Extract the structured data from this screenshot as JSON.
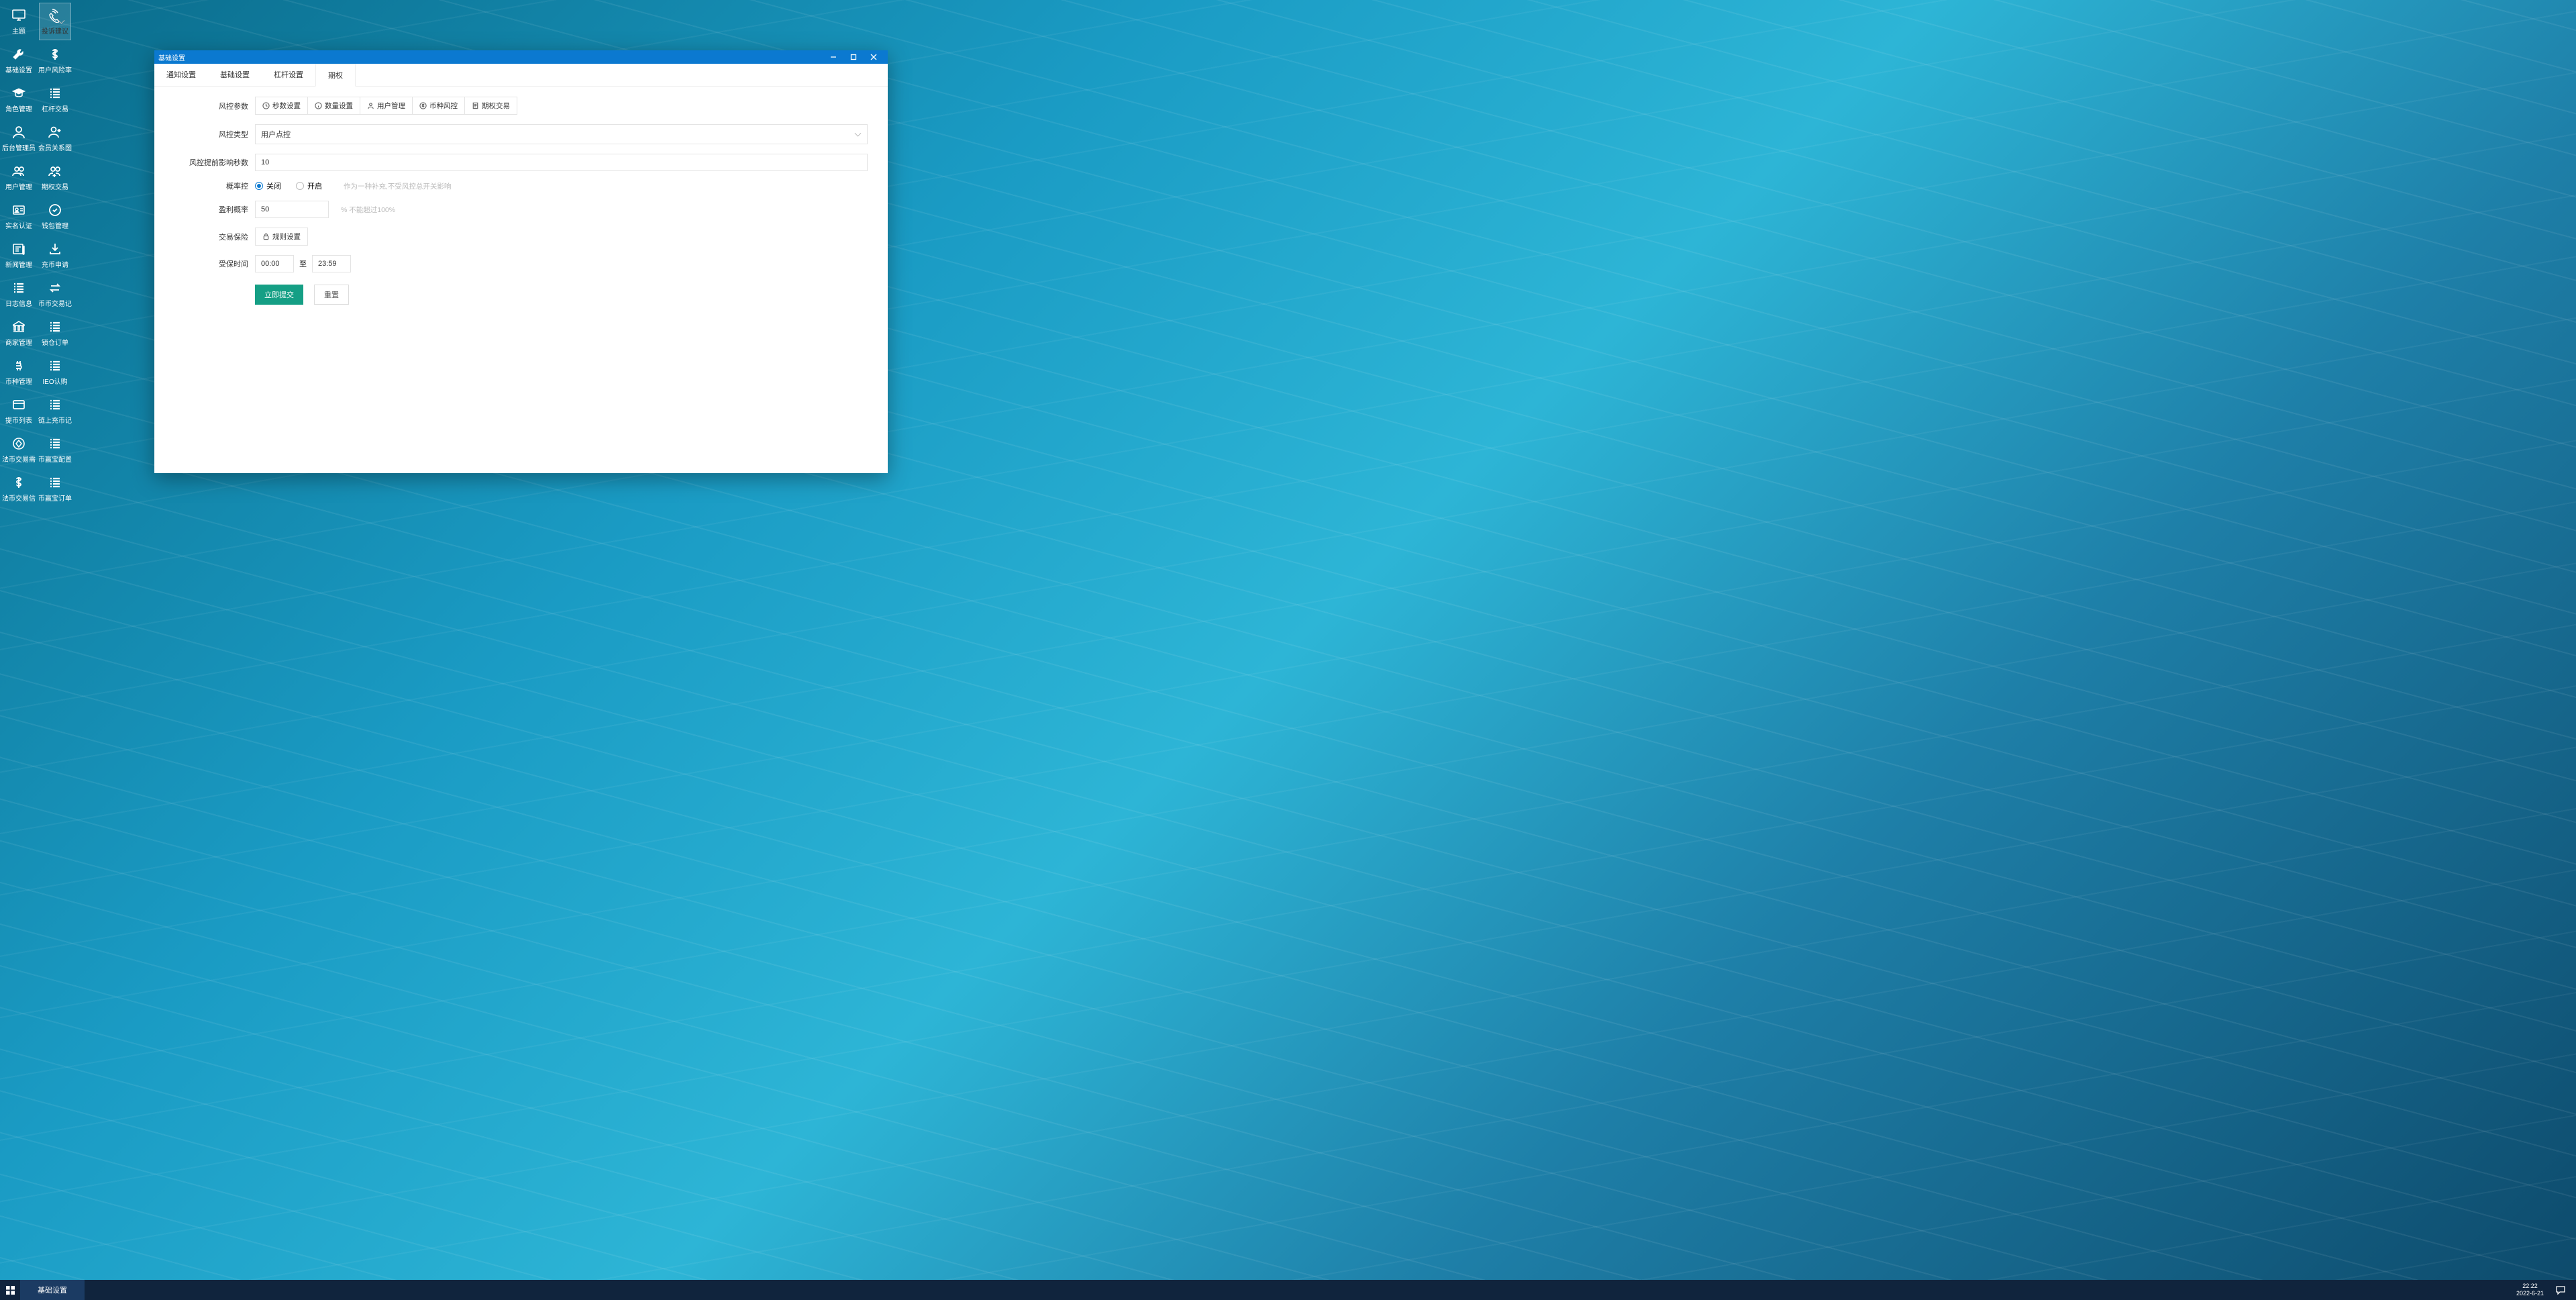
{
  "desktop": [
    {
      "icon": "monitor",
      "label": "主题"
    },
    {
      "icon": "phone",
      "label": "投诉建议",
      "sel": true
    },
    {
      "icon": "wrench",
      "label": "基础设置"
    },
    {
      "icon": "dollar",
      "label": "用户风险率"
    },
    {
      "icon": "grad",
      "label": "角色管理"
    },
    {
      "icon": "list",
      "label": "杠杆交易"
    },
    {
      "icon": "user",
      "label": "后台管理员"
    },
    {
      "icon": "userplus",
      "label": "会员关系图"
    },
    {
      "icon": "users",
      "label": "用户管理"
    },
    {
      "icon": "usersplus",
      "label": "期权交易"
    },
    {
      "icon": "idcheck",
      "label": "实名认证"
    },
    {
      "icon": "wallet",
      "label": "钱包管理"
    },
    {
      "icon": "news",
      "label": "新闻管理"
    },
    {
      "icon": "deposit",
      "label": "充币申请"
    },
    {
      "icon": "list",
      "label": "日志信息"
    },
    {
      "icon": "swap",
      "label": "币币交易记"
    },
    {
      "icon": "bank",
      "label": "商家管理"
    },
    {
      "icon": "list",
      "label": "锁仓订单"
    },
    {
      "icon": "bitcoin",
      "label": "币种管理"
    },
    {
      "icon": "list",
      "label": "IEO认购"
    },
    {
      "icon": "card",
      "label": "提币列表"
    },
    {
      "icon": "list",
      "label": "链上充币记"
    },
    {
      "icon": "diamond",
      "label": "法币交易需"
    },
    {
      "icon": "list",
      "label": "币赢宝配置"
    },
    {
      "icon": "dollar",
      "label": "法币交易信"
    },
    {
      "icon": "list",
      "label": "币赢宝订单"
    }
  ],
  "window": {
    "title": "基础设置",
    "tabs": [
      "通知设置",
      "基础设置",
      "杠杆设置",
      "期权"
    ],
    "activeTab": 3,
    "form": {
      "riskParam": {
        "label": "风控参数",
        "buttons": [
          {
            "icon": "clock",
            "text": "秒数设置"
          },
          {
            "icon": "info",
            "text": "数量设置"
          },
          {
            "icon": "person",
            "text": "用户管理"
          },
          {
            "icon": "coin",
            "text": "币种风控"
          },
          {
            "icon": "doc",
            "text": "期权交易"
          }
        ]
      },
      "riskType": {
        "label": "风控类型",
        "value": "用户点控"
      },
      "preSeconds": {
        "label": "风控提前影响秒数",
        "value": "10"
      },
      "probCtrl": {
        "label": "概率控",
        "options": [
          "关闭",
          "开启"
        ],
        "selected": 0,
        "hint": "作为一种补充,不受风控总开关影响"
      },
      "profitProb": {
        "label": "盈利概率",
        "value": "50",
        "hint": "%  不能超过100%"
      },
      "insurance": {
        "label": "交易保险",
        "button": "规则设置"
      },
      "coverTime": {
        "label": "受保时间",
        "from": "00:00",
        "to": "23:59",
        "sep": "至"
      },
      "submit": "立即提交",
      "reset": "重置"
    }
  },
  "taskbar": {
    "task": "基础设置",
    "time": "22:22",
    "date": "2022-6-21"
  }
}
